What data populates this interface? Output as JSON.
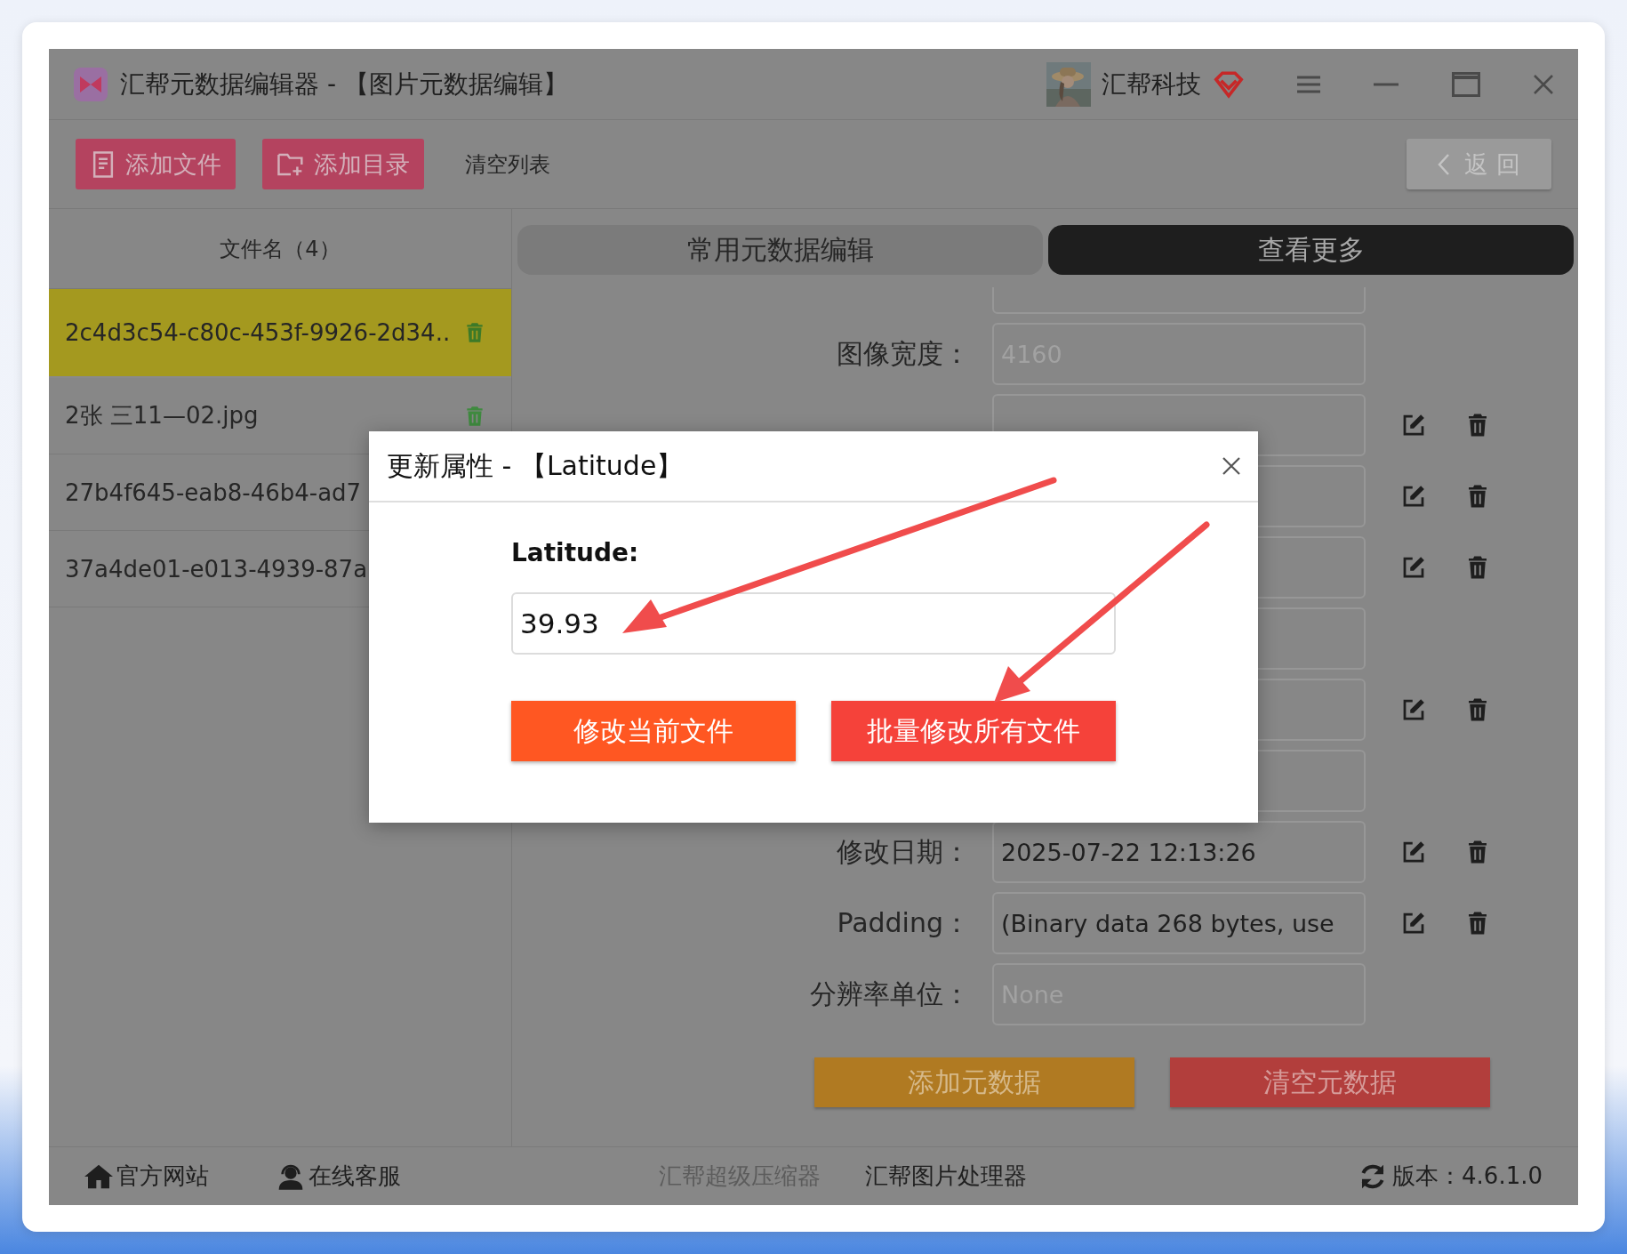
{
  "window": {
    "title": "汇帮元数据编辑器 - 【图片元数据编辑】",
    "user": "汇帮科技"
  },
  "toolbar": {
    "buttons": [
      {
        "label": "添加文件",
        "kind": "file"
      },
      {
        "label": "添加目录",
        "kind": "folder"
      },
      {
        "label": "清空列表",
        "kind": "text"
      }
    ],
    "back": "返 回"
  },
  "file_list": {
    "header": "文件名（4）",
    "items": [
      {
        "name": "2c4d3c54-c80c-453f-9926-2d34..",
        "selected": true,
        "trash_icon": true
      },
      {
        "name": "2张 三11—02.jpg",
        "selected": false,
        "trash_icon": true
      },
      {
        "name": "27b4f645-eab8-46b4-ad7",
        "selected": false,
        "trash_icon": false
      },
      {
        "name": "37a4de01-e013-4939-87a",
        "selected": false,
        "trash_icon": false
      }
    ]
  },
  "tabs": [
    {
      "label": "常用元数据编辑",
      "selected": false
    },
    {
      "label": "查看更多",
      "selected": true
    }
  ],
  "fields": [
    {
      "actions": false
    },
    {
      "label": "图像宽度：",
      "value": "4160",
      "disabled": true,
      "actions": false
    },
    {
      "actions": true
    },
    {
      "actions": true
    },
    {
      "actions": true
    },
    {
      "actions": false
    },
    {
      "actions": true
    },
    {
      "actions": false
    },
    {
      "label": "修改日期：",
      "value": "2025-07-22 12:13:26",
      "disabled": false,
      "actions": true
    },
    {
      "label": "Padding：",
      "value": "(Binary data 268 bytes, use",
      "disabled": false,
      "actions": true
    },
    {
      "label": "分辨率单位：",
      "value": "None",
      "disabled": true,
      "actions": false
    }
  ],
  "actions": [
    {
      "label": "添加元数据",
      "kind": "add"
    },
    {
      "label": "清空元数据",
      "kind": "clear"
    }
  ],
  "footer": {
    "links": [
      {
        "label": "官方网站",
        "kind": "home"
      },
      {
        "label": "在线客服",
        "kind": "support"
      },
      {
        "label": "汇帮超级压缩器",
        "kind": "muted"
      },
      {
        "label": "汇帮图片处理器",
        "kind": "plain"
      }
    ],
    "version": "版本：4.6.1.0"
  },
  "dialog": {
    "title": "更新属性 - 【Latitude】",
    "label": "Latitude:",
    "value": "39.93",
    "buttons": [
      {
        "label": "修改当前文件",
        "kind": "current"
      },
      {
        "label": "批量修改所有文件",
        "kind": "all"
      }
    ]
  }
}
